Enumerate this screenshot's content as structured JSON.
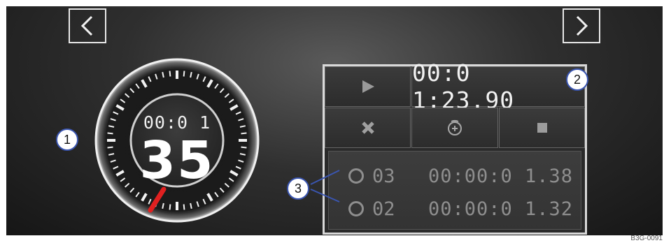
{
  "nav": {
    "prev_icon": "chevron-left-icon",
    "next_icon": "chevron-right-icon"
  },
  "dial": {
    "minutes_seconds": "00:0 1",
    "seconds_large": "35",
    "marker_color": "#e02020"
  },
  "controls": {
    "elapsed_time": "00:0 1:23.90",
    "play_icon": "play-icon",
    "reset_icon": "close-icon",
    "lap_icon": "lap-timer-icon",
    "stop_icon": "stop-icon"
  },
  "laps": [
    {
      "number": "03",
      "time": "00:00:0 1.38"
    },
    {
      "number": "02",
      "time": "00:00:0 1.32"
    }
  ],
  "callouts": {
    "one": "1",
    "two": "2",
    "three": "3"
  },
  "reference_code": "B3G-0091"
}
